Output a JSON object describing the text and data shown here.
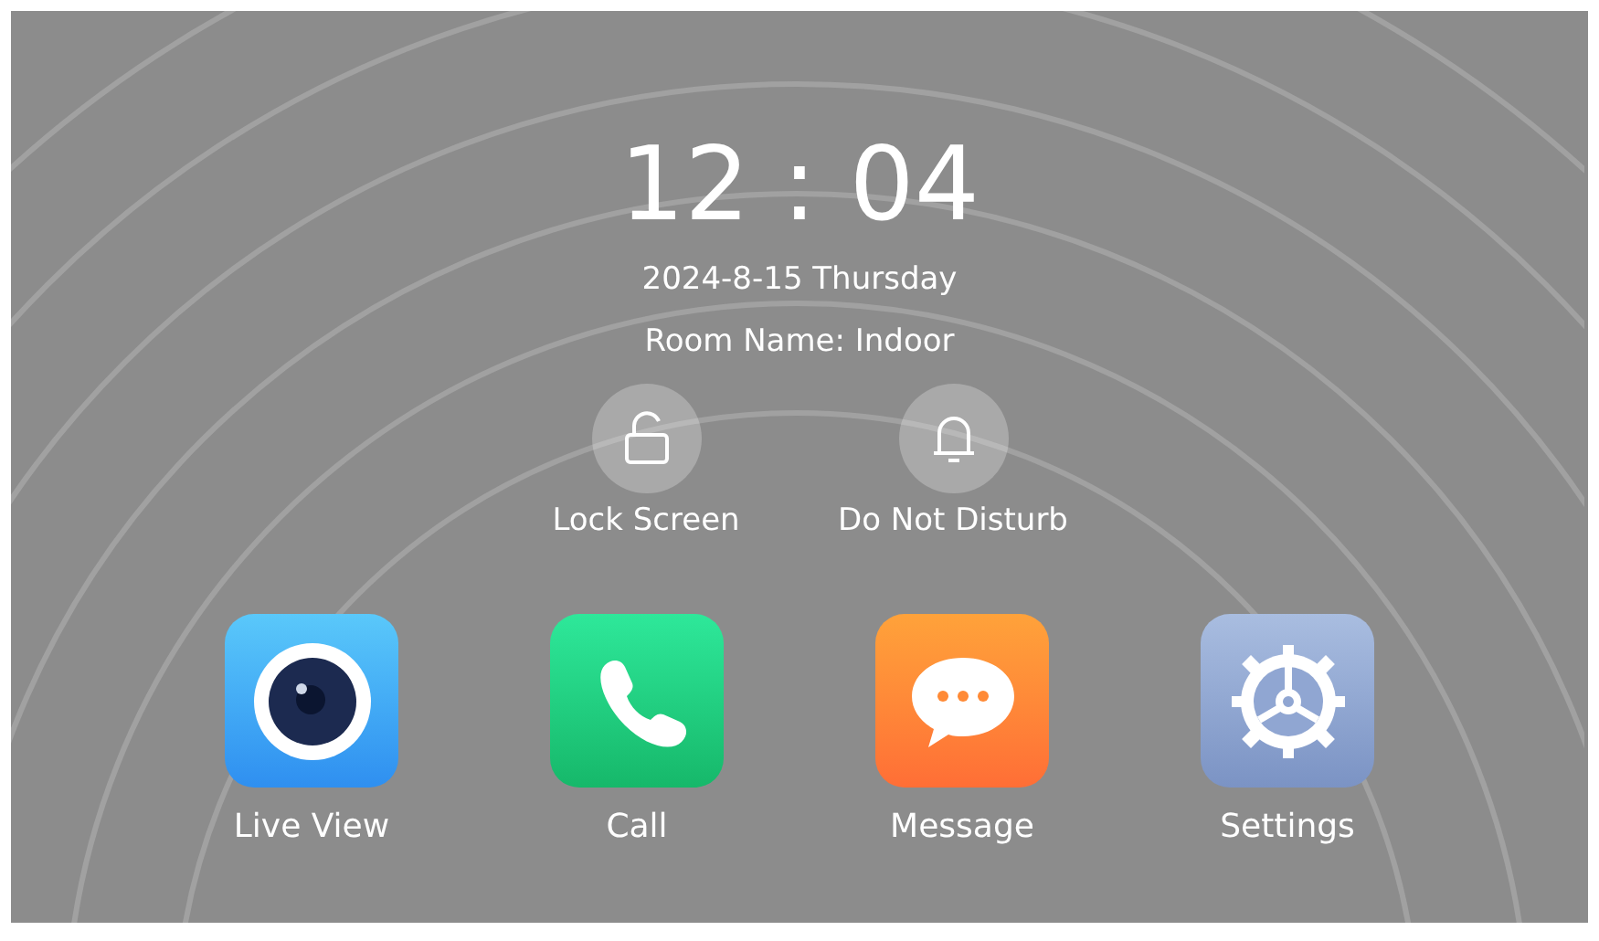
{
  "clock": {
    "time": "12 : 04",
    "date": "2024-8-15 Thursday",
    "room": "Room Name: Indoor"
  },
  "quick_actions": [
    {
      "kind": "lock",
      "label": "Lock Screen"
    },
    {
      "kind": "bell",
      "label": "Do Not Disturb"
    }
  ],
  "apps": [
    {
      "kind": "camera",
      "label": "Live View"
    },
    {
      "kind": "phone",
      "label": "Call"
    },
    {
      "kind": "chat",
      "label": "Message"
    },
    {
      "kind": "gear",
      "label": "Settings"
    }
  ]
}
